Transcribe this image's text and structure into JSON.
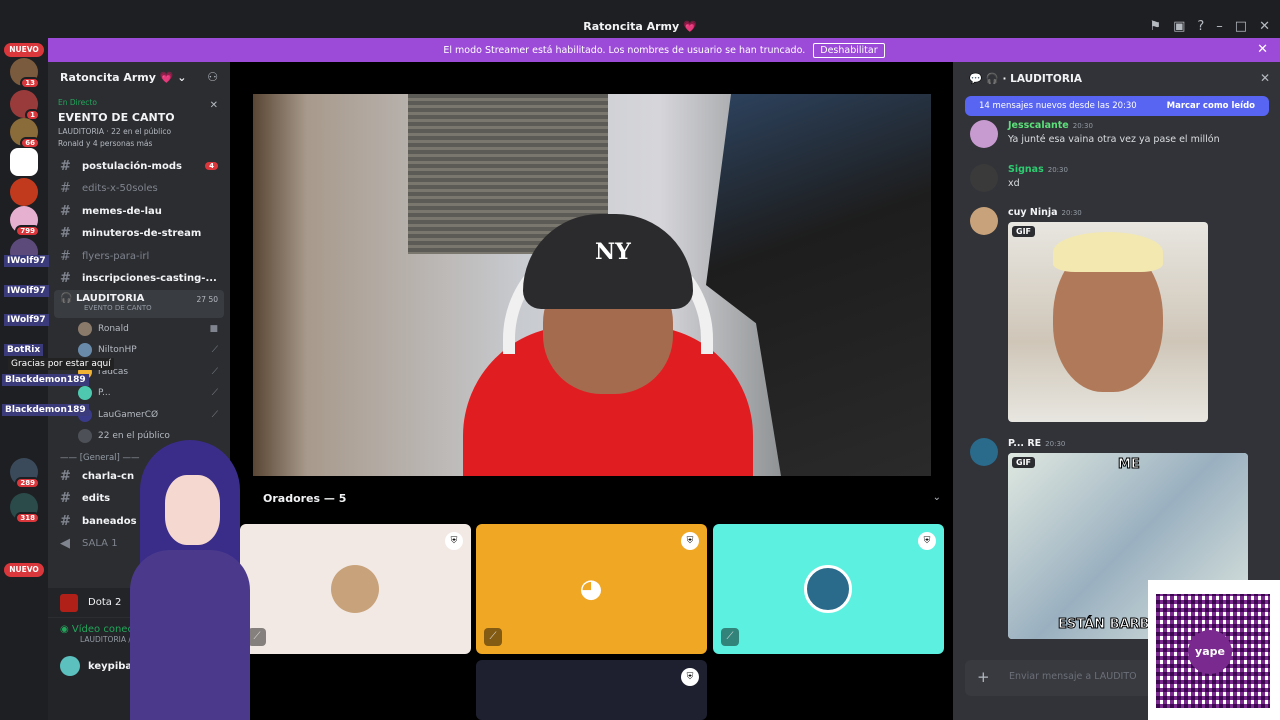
{
  "window": {
    "title": "Ratoncita Army 💗"
  },
  "banner": {
    "text": "El modo Streamer está habilitado. Los nombres de usuario se han truncado.",
    "button": "Deshabilitar"
  },
  "guilds": {
    "badges": [
      "NUEVO",
      "13",
      "1",
      "66",
      "799",
      "289",
      "318",
      "NUEVO"
    ]
  },
  "server": {
    "name": "Ratoncita Army 💗"
  },
  "live_event": {
    "label": "En Directo",
    "title": "EVENTO DE CANTO",
    "meta": "LAUDITORIA · 22 en el público",
    "attendees": "Ronald y 4 personas más"
  },
  "channels": [
    {
      "name": "postulación-mods",
      "count": "4",
      "bold": true
    },
    {
      "name": "edits-x-50soles",
      "bold": false
    },
    {
      "name": "memes-de-lau",
      "bold": true
    },
    {
      "name": "minuteros-de-stream",
      "bold": true
    },
    {
      "name": "flyers-para-irl",
      "bold": false
    },
    {
      "name": "inscripciones-casting-...",
      "bold": true
    }
  ],
  "voice_channel": {
    "name": "LAUDITORIA",
    "sub": "EVENTO DE CANTO",
    "count": "27 50"
  },
  "voice_users": [
    "Ronald",
    "NiltonHP",
    "radcas",
    "P...",
    "LauGamerCØ",
    "22 en el público"
  ],
  "category": "—— [General] ——",
  "channels2": [
    "charla-cn",
    "edits",
    "baneados",
    "SALA 1"
  ],
  "bottom": {
    "game": "Dota 2",
    "voice_status": "Vídeo conectado",
    "voice_sub": "LAUDITORIA / Rat",
    "user": "keypibara"
  },
  "overlays": {
    "botrix": "BotRix",
    "botrix_msg": "Gracias por estar aquí",
    "u1": "IWolf97",
    "u2": "IWolf97",
    "u3": "IWolf97",
    "u4": "Blackdemon189",
    "u5": "Blackdemon189"
  },
  "stage": {
    "orators_label": "Oradores — 5"
  },
  "chat": {
    "channel": "LAUDITORIA",
    "new_messages": "14 mensajes nuevos desde las 20:30",
    "mark_read": "Marcar como leído",
    "messages": [
      {
        "author": "Jessca​lante",
        "time": "20:30",
        "text": "Ya junté esa vaina otra vez ya pase el millón",
        "color": "#5ce07a"
      },
      {
        "author": "Signas",
        "time": "20:30",
        "text": "xd",
        "color": "#2ecc71"
      },
      {
        "author": "cuy Ninja",
        "time": "20:30",
        "text": "",
        "color": "#f2f3f5"
      },
      {
        "author": "P... RE",
        "time": "20:30",
        "text": "",
        "color": "#f2f3f5"
      }
    ],
    "gif_label": "GIF",
    "meme_top": "ME",
    "meme_bottom": "ESTÁN BARB",
    "input_placeholder": "Enviar mensaje a  LAUDITO"
  },
  "qr": {
    "brand": "yape"
  },
  "colors": {
    "accent": "#5865f2",
    "banner": "#9b4bd8",
    "live": "#23a55a",
    "danger": "#da373c"
  }
}
